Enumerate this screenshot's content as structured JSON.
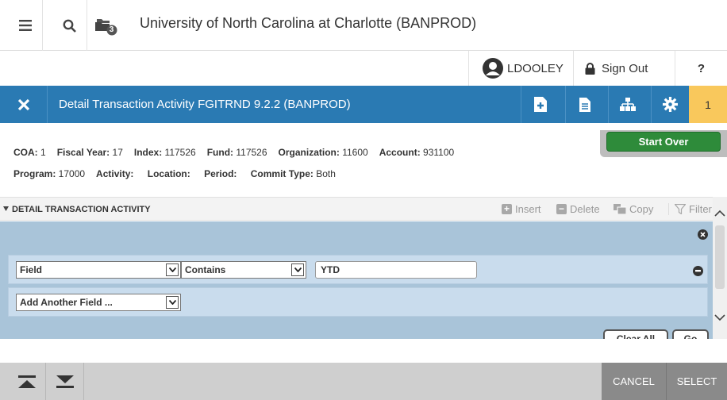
{
  "app": {
    "institution": "University of North Carolina at Charlotte (BANPROD)",
    "recent_badge": "3"
  },
  "user": {
    "name": "LDOOLEY",
    "sign_out": "Sign Out",
    "help": "?"
  },
  "page": {
    "title": "Detail Transaction Activity FGITRND 9.2.2 (BANPROD)",
    "notifications": "1"
  },
  "key_block": {
    "line1": [
      {
        "label": "COA:",
        "value": "1"
      },
      {
        "label": "Fiscal Year:",
        "value": "17"
      },
      {
        "label": "Index:",
        "value": "117526"
      },
      {
        "label": "Fund:",
        "value": "117526"
      },
      {
        "label": "Organization:",
        "value": "11600"
      },
      {
        "label": "Account:",
        "value": "931100"
      }
    ],
    "line2": [
      {
        "label": "Program:",
        "value": "17000"
      },
      {
        "label": "Activity:",
        "value": ""
      },
      {
        "label": "Location:",
        "value": ""
      },
      {
        "label": "Period:",
        "value": ""
      },
      {
        "label": "Commit Type:",
        "value": "Both"
      }
    ],
    "start_over": "Start Over"
  },
  "section": {
    "title": "DETAIL TRANSACTION ACTIVITY",
    "insert": "Insert",
    "delete": "Delete",
    "copy": "Copy",
    "filter": "Filter"
  },
  "filter": {
    "field_select": "Field",
    "operator_select": "Contains",
    "value": "YTD",
    "add_field": "Add Another Field ...",
    "clear_all": "Clear All",
    "go": "Go"
  },
  "footer": {
    "cancel": "CANCEL",
    "select": "SELECT"
  },
  "colors": {
    "header_blue": "#2a7ab3",
    "start_over_green": "#2e8b3a",
    "notification_yellow": "#f9c85c",
    "filter_panel": "#a9c4d9"
  }
}
